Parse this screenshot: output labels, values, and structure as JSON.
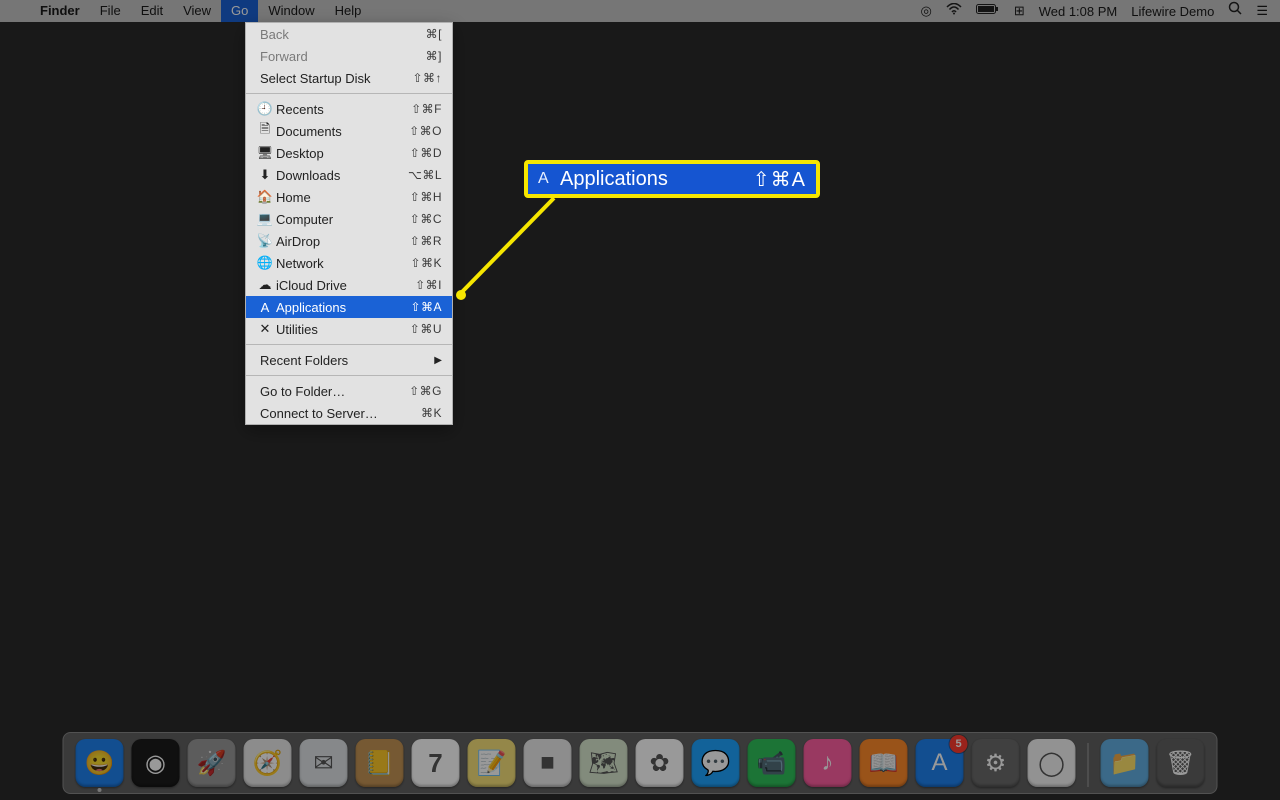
{
  "menubar": {
    "app": "Finder",
    "items": [
      "File",
      "Edit",
      "View",
      "Go",
      "Window",
      "Help"
    ],
    "active": "Go",
    "status": {
      "cloud": "☁",
      "wifi": "⏚",
      "battery": "🔋",
      "input": "⌨",
      "datetime": "Wed 1:08 PM",
      "user": "Lifewire Demo",
      "search": "🔍",
      "list": "≣"
    }
  },
  "menu": {
    "nav": [
      {
        "label": "Back",
        "shortcut": "⌘[",
        "disabled": true
      },
      {
        "label": "Forward",
        "shortcut": "⌘]",
        "disabled": true
      },
      {
        "label": "Select Startup Disk",
        "shortcut": "⇧⌘↑",
        "disabled": false
      }
    ],
    "locations": [
      {
        "icon": "🕘",
        "label": "Recents",
        "shortcut": "⇧⌘F"
      },
      {
        "icon": "🗎",
        "label": "Documents",
        "shortcut": "⇧⌘O"
      },
      {
        "icon": "🖥",
        "label": "Desktop",
        "shortcut": "⇧⌘D"
      },
      {
        "icon": "⬇︎",
        "label": "Downloads",
        "shortcut": "⌥⌘L"
      },
      {
        "icon": "🏠",
        "label": "Home",
        "shortcut": "⇧⌘H"
      },
      {
        "icon": "💻",
        "label": "Computer",
        "shortcut": "⇧⌘C"
      },
      {
        "icon": "📡",
        "label": "AirDrop",
        "shortcut": "⇧⌘R"
      },
      {
        "icon": "🌐",
        "label": "Network",
        "shortcut": "⇧⌘K"
      },
      {
        "icon": "☁︎",
        "label": "iCloud Drive",
        "shortcut": "⇧⌘I"
      },
      {
        "icon": "A",
        "label": "Applications",
        "shortcut": "⇧⌘A",
        "selected": true
      },
      {
        "icon": "✕",
        "label": "Utilities",
        "shortcut": "⇧⌘U"
      }
    ],
    "recent": {
      "label": "Recent Folders"
    },
    "bottom": [
      {
        "label": "Go to Folder…",
        "shortcut": "⇧⌘G"
      },
      {
        "label": "Connect to Server…",
        "shortcut": "⌘K"
      }
    ]
  },
  "callout": {
    "icon": "A",
    "label": "Applications",
    "shortcut": "⇧⌘A"
  },
  "dock": {
    "items": [
      {
        "name": "finder",
        "glyph": "😀",
        "bg": "#1e82f0",
        "running": true
      },
      {
        "name": "siri",
        "glyph": "◉",
        "bg": "#1b1b1b"
      },
      {
        "name": "launchpad",
        "glyph": "🚀",
        "bg": "#9a9a9a"
      },
      {
        "name": "safari",
        "glyph": "🧭",
        "bg": "#e9e9e9"
      },
      {
        "name": "mail",
        "glyph": "✉︎",
        "bg": "#dfe3e6"
      },
      {
        "name": "contacts",
        "glyph": "📒",
        "bg": "#c59455"
      },
      {
        "name": "calendar",
        "glyph": "7",
        "bg": "#ffffff"
      },
      {
        "name": "notes",
        "glyph": "📝",
        "bg": "#f7e27a"
      },
      {
        "name": "reminders",
        "glyph": "■",
        "bg": "#ececec"
      },
      {
        "name": "maps",
        "glyph": "🗺",
        "bg": "#d9e8cf"
      },
      {
        "name": "photos",
        "glyph": "✿",
        "bg": "#ffffff"
      },
      {
        "name": "messages",
        "glyph": "💬",
        "bg": "#1fa4ff"
      },
      {
        "name": "facetime",
        "glyph": "📹",
        "bg": "#2fc15a"
      },
      {
        "name": "itunes",
        "glyph": "♪",
        "bg": "#ff5fa2"
      },
      {
        "name": "ibooks",
        "glyph": "📖",
        "bg": "#ff8a2a"
      },
      {
        "name": "appstore",
        "glyph": "A",
        "bg": "#1e82f0",
        "badge": "5"
      },
      {
        "name": "preferences",
        "glyph": "⚙︎",
        "bg": "#6b6b6b"
      },
      {
        "name": "chrome",
        "glyph": "◯",
        "bg": "#f4f4f4"
      }
    ],
    "right": [
      {
        "name": "downloads-stack",
        "glyph": "📁",
        "bg": "#63b0e3"
      },
      {
        "name": "trash",
        "glyph": "🗑",
        "bg": "transparent"
      }
    ]
  }
}
